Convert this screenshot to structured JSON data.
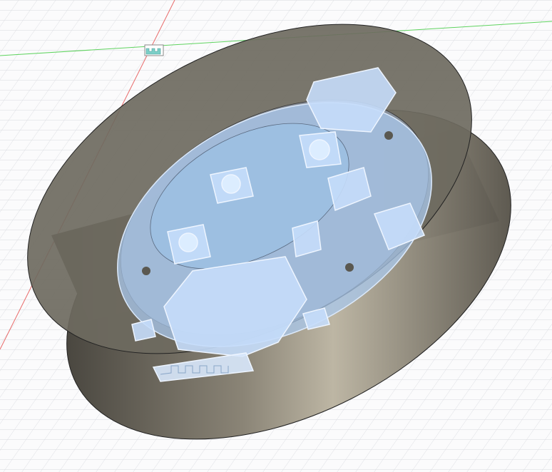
{
  "viewport": {
    "background": "#fbfbfc",
    "grid_color": "#d9dbe0",
    "axis_x_color": "#5fd35f",
    "axis_y_color": "#e86a6a"
  },
  "model": {
    "enclosure_color": "#6e6a60",
    "pcb_color": "#a9c8ec",
    "component_color": "#c5ddfb"
  },
  "icons": [
    "origin-marker-icon"
  ]
}
